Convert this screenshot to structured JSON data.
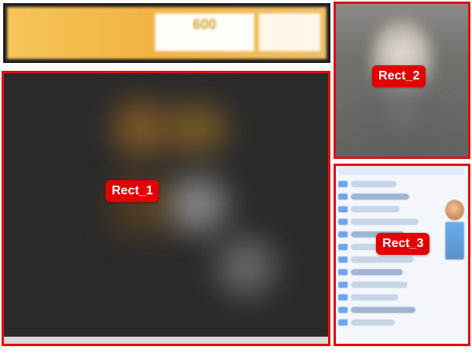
{
  "banner": {
    "left_text": "",
    "center_number": "600",
    "center_subtext": "",
    "right_text": "",
    "colors": {
      "frame": "#202020",
      "background": "#f2b443",
      "accent": "#d1a037"
    }
  },
  "annotations": {
    "rect_1": {
      "label": "Rect_1",
      "icon": "video-area"
    },
    "rect_2": {
      "label": "Rect_2",
      "icon": "camera-view"
    },
    "rect_3": {
      "label": "Rect_3",
      "icon": "chat-panel"
    }
  },
  "panels": {
    "main_video": {
      "background": "#2a2a2a"
    },
    "camera": {
      "background": "#73716c"
    },
    "chat": {
      "background": "#f3f6fb",
      "accent": "#6fa4e9"
    }
  }
}
